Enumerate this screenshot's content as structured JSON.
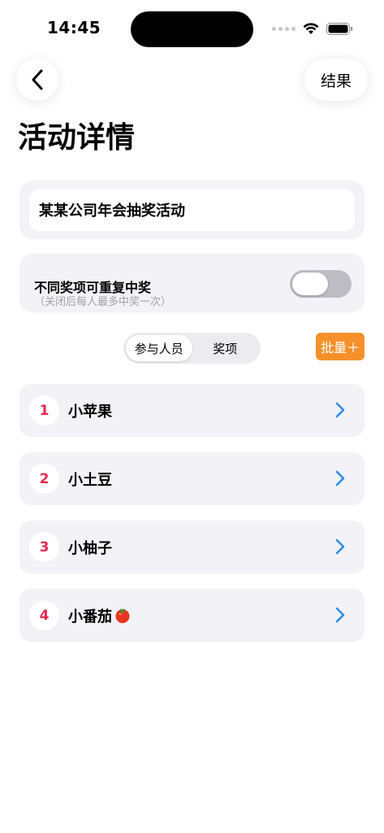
{
  "status_bar": {
    "time": "14:45"
  },
  "nav": {
    "result_label": "结果"
  },
  "page": {
    "title": "活动详情"
  },
  "activity": {
    "name": "某某公司年会抽奖活动"
  },
  "repeat_option": {
    "title": "不同奖项可重复中奖",
    "subtitle": "（关闭后每人最多中奖一次）",
    "enabled": false
  },
  "segmented": {
    "tabs": [
      "参与人员",
      "奖项"
    ],
    "selected": "参与人员"
  },
  "batch_label": "批量＋",
  "participants": [
    {
      "index": "1",
      "name": "小苹果"
    },
    {
      "index": "2",
      "name": "小土豆"
    },
    {
      "index": "3",
      "name": "小柚子"
    },
    {
      "index": "4",
      "name": "小番茄"
    }
  ],
  "colors": {
    "accent_orange": "#f5902b",
    "badge_red": "#e6294f",
    "chevron_blue": "#2f8fe6",
    "card_bg": "#f2f2f7"
  }
}
